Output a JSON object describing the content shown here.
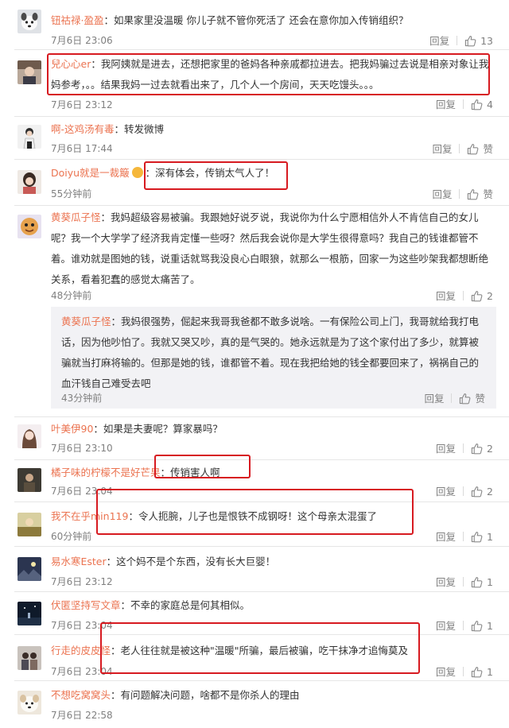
{
  "ui": {
    "reply_label": "回复",
    "like_label": "赞",
    "colon": "："
  },
  "comments": [
    {
      "user": "钮祜禄·盈盈",
      "text": "如果家里没温暖 你儿子就不管你死活了 还会在意你加入传销组织？",
      "time": "7月6日 23:06",
      "likes": "13"
    },
    {
      "user": "兒心心er",
      "text": "我阿姨就是进去，还想把家里的爸妈各种亲戚都拉进去。把我妈骗过去说是相亲对象让我妈参考，。。结果我妈一过去就看出来了，几个人一个房间，天天吃馒头。。。",
      "time": "7月6日 23:12",
      "likes": "4"
    },
    {
      "user": "啊-这鸡汤有毒",
      "text": "转发微博",
      "time": "7月6日 17:44",
      "likes": "赞"
    },
    {
      "user": "Doiyu就是一裁簸",
      "text": "深有体会，传销太气人了！",
      "time": "55分钟前",
      "likes": "赞"
    },
    {
      "user": "黄葵瓜子怪",
      "text": "我妈超级容易被骗。我跟她好说歹说，我说你为什么宁愿相信外人不肯信自己的女儿呢？我一个大学学了经济我肯定懂一些呀？然后我会说你是大学生很得意吗？我自己的钱谁都管不着。谁劝就是图她的钱，说重话就骂我没良心白眼狼，就那么一根筋，回家一为这些吵架我都想断绝关系，看着犯蠢的感觉太痛苦了。",
      "time": "48分钟前",
      "likes": "2"
    },
    {
      "user": "叶美伊90",
      "text": "如果是夫妻呢？算家暴吗？",
      "time": "7月6日 23:10",
      "likes": "2"
    },
    {
      "user": "橘子味的柠檬不是好芒果",
      "text": "传销害人啊",
      "time": "7月6日 23:04",
      "likes": "2"
    },
    {
      "user": "我不在乎min119",
      "text": "令人扼腕，儿子也是恨铁不成钢呀！这个母亲太混蛋了",
      "time": "60分钟前",
      "likes": "1"
    },
    {
      "user": "易水寒Ester",
      "text": "这个妈不是个东西，没有长大巨婴！",
      "time": "7月6日 23:12",
      "likes": "1"
    },
    {
      "user": "伏匿坚持写文章",
      "text": "不幸的家庭总是何其相似。",
      "time": "7月6日 23:04",
      "likes": "1"
    },
    {
      "user": "行走的皮皮怪",
      "text": "老人往往就是被这种\"温暖\"所骗，最后被骗，吃干抹净才追悔莫及",
      "time": "7月6日 23:04",
      "likes": "1"
    },
    {
      "user": "不想吃窝窝头",
      "text": "有问题解决问题，啥都不是你杀人的理由",
      "time": "7月6日 22:58",
      "likes": "1"
    }
  ],
  "nested_reply": {
    "user": "黄葵瓜子怪",
    "text": "我妈很强势，倔起来我哥我爸都不敢多说啥。一有保险公司上门，我哥就给我打电话，因为他吵怕了。我就又哭又吵，真的是气哭的。她永远就是为了这个家付出了多少，就算被骗就当打麻将输的。但那是她的钱，谁都管不着。现在我把给她的钱全都要回来了，祸祸自己的血汗钱自己难受去吧",
    "time": "43分钟前",
    "likes": "赞"
  },
  "colors": {
    "username": "#eb7350",
    "highlight_box": "#d71a20",
    "meta_gray": "#808080"
  }
}
